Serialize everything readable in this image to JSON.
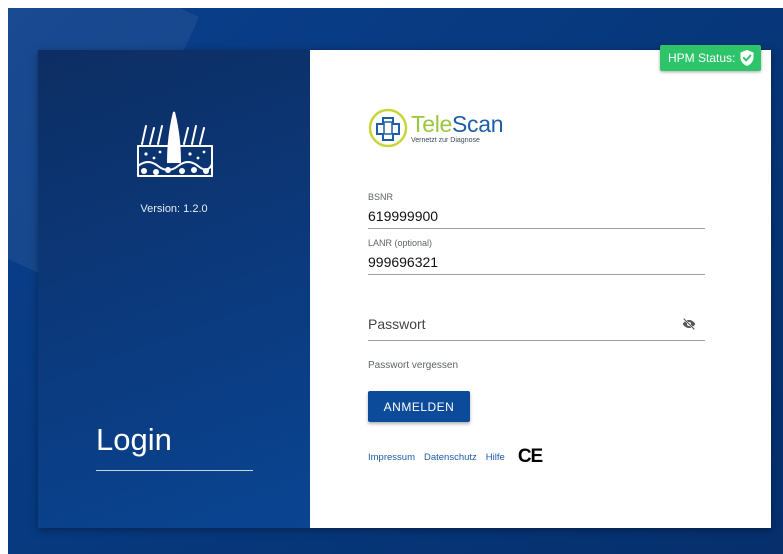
{
  "left": {
    "version_text": "Version: 1.2.0",
    "login_title": "Login",
    "icon": "skin-layers-icon"
  },
  "status": {
    "label": "HPM Status:",
    "icon": "shield-check-icon",
    "color": "#2ec56a"
  },
  "logo": {
    "brand_part1": "Tele",
    "brand_part2": "Scan",
    "tagline": "Vernetzt zur Diagnose"
  },
  "form": {
    "bsnr_label": "BSNR",
    "bsnr_value": "619999900",
    "lanr_label": "LANR (optional)",
    "lanr_value": "999696321",
    "password_placeholder": "Passwort",
    "password_toggle_icon": "eye-off-icon",
    "forgot_link": "Passwort vergessen",
    "submit_label": "ANMELDEN"
  },
  "footer": {
    "links": [
      "Impressum",
      "Datenschutz",
      "Hilfe"
    ],
    "ce_mark": "CE"
  },
  "colors": {
    "background": "#0b3f8c",
    "left_panel": "#0d2e63",
    "button": "#0c4a9a",
    "link": "#1e5aa8"
  }
}
